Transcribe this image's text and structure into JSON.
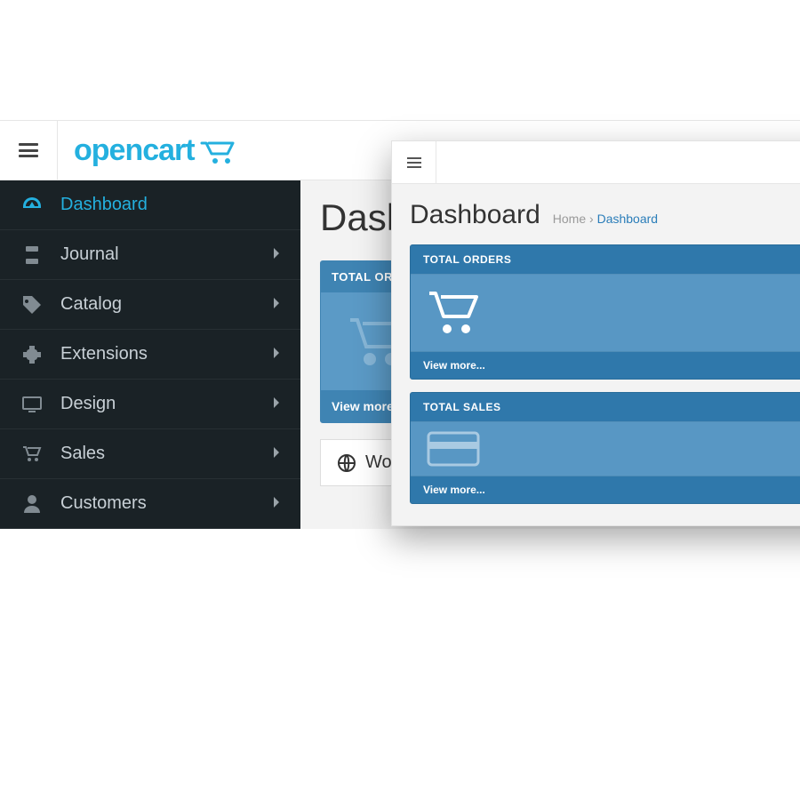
{
  "header": {
    "logo_text": "opencart"
  },
  "sidebar": {
    "items": [
      {
        "label": "Dashboard",
        "icon": "dashboard-icon",
        "active": true,
        "expandable": false
      },
      {
        "label": "Journal",
        "icon": "journal-icon",
        "active": false,
        "expandable": true
      },
      {
        "label": "Catalog",
        "icon": "tag-icon",
        "active": false,
        "expandable": true
      },
      {
        "label": "Extensions",
        "icon": "puzzle-icon",
        "active": false,
        "expandable": true
      },
      {
        "label": "Design",
        "icon": "monitor-icon",
        "active": false,
        "expandable": true
      },
      {
        "label": "Sales",
        "icon": "cart-icon",
        "active": false,
        "expandable": true
      },
      {
        "label": "Customers",
        "icon": "user-icon",
        "active": false,
        "expandable": true
      }
    ]
  },
  "main": {
    "title": "Dashboard",
    "tile_orders": {
      "label": "TOTAL ORDERS",
      "label_trunc": "TOTAL ORD",
      "view_more": "View more..."
    },
    "world_map": "World Map"
  },
  "overlay": {
    "title": "Dashboard",
    "breadcrumb_home": "Home",
    "breadcrumb_sep": "›",
    "breadcrumb_current": "Dashboard",
    "cards": {
      "orders": {
        "label": "TOTAL ORDERS",
        "view_more": "View more..."
      },
      "sales": {
        "label": "TOTAL SALES",
        "view_more": "View more..."
      }
    }
  }
}
